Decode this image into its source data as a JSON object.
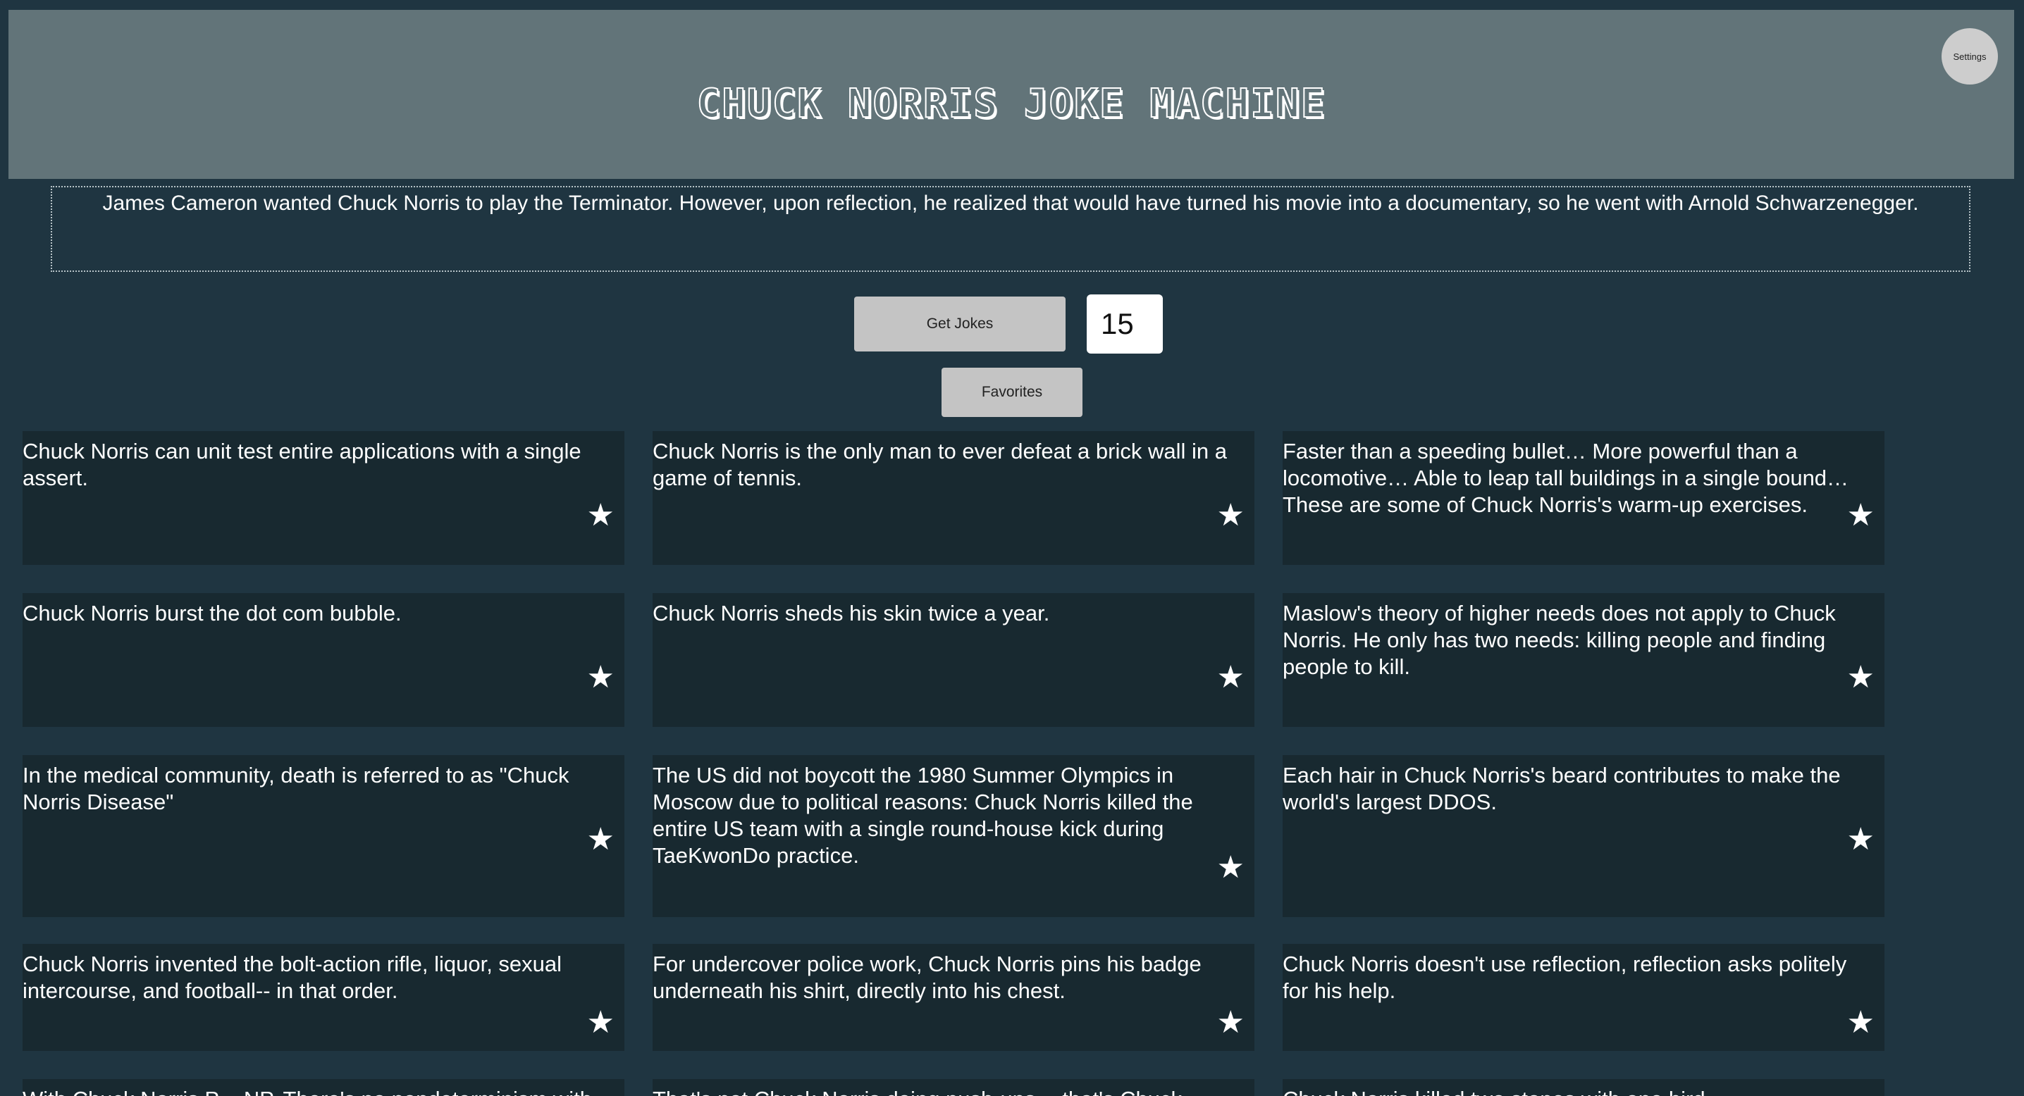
{
  "header": {
    "title": "CHUCK NORRIS JOKE MACHINE",
    "settings_label": "Settings"
  },
  "featured_joke": "James Cameron wanted Chuck Norris to play the Terminator. However, upon reflection, he realized that would have turned his movie into a documentary, so he went with Arnold Schwarzenegger.",
  "controls": {
    "get_jokes_label": "Get Jokes",
    "joke_count_value": "15",
    "favorites_label": "Favorites"
  },
  "jokes": [
    {
      "text": "Chuck Norris can unit test entire applications with a single assert.",
      "star_icon": "star-icon"
    },
    {
      "text": "Chuck Norris is the only man to ever defeat a brick wall in a game of tennis.",
      "star_icon": "star-icon"
    },
    {
      "text": "Faster than a speeding bullet… More powerful than a locomotive… Able to leap tall buildings in a single bound… These are some of Chuck Norris's warm-up exercises.",
      "star_icon": "star-icon"
    },
    {
      "text": "Chuck Norris burst the dot com bubble.",
      "star_icon": "star-icon"
    },
    {
      "text": "Chuck Norris sheds his skin twice a year.",
      "star_icon": "star-icon"
    },
    {
      "text": "Maslow's theory of higher needs does not apply to Chuck Norris. He only has two needs: killing people and finding people to kill.",
      "star_icon": "star-icon"
    },
    {
      "text": "In the medical community, death is referred to as \"Chuck Norris Disease\"",
      "star_icon": "star-icon"
    },
    {
      "text": "The US did not boycott the 1980 Summer Olympics in Moscow due to political reasons: Chuck Norris killed the entire US team with a single round-house kick during TaeKwonDo practice.",
      "star_icon": "star-icon"
    },
    {
      "text": "Each hair in Chuck Norris's beard contributes to make the world's largest DDOS.",
      "star_icon": "star-icon"
    },
    {
      "text": "Chuck Norris invented the bolt-action rifle, liquor, sexual intercourse, and football-- in that order.",
      "star_icon": "star-icon"
    },
    {
      "text": "For undercover police work, Chuck Norris pins his badge underneath his shirt, directly into his chest.",
      "star_icon": "star-icon"
    },
    {
      "text": "Chuck Norris doesn't use reflection, reflection asks politely for his help.",
      "star_icon": "star-icon"
    },
    {
      "text": "With Chuck Norris P = NP. There's no nondeterminism with Chuck Norris decisions.",
      "star_icon": "star-icon"
    },
    {
      "text": "That's not Chuck Norris doing push-ups -- that's Chuck Norris moving the Earth away from his body.",
      "star_icon": "star-icon"
    },
    {
      "text": "Chuck Norris killed two stones with one bird.",
      "star_icon": "star-icon"
    }
  ]
}
